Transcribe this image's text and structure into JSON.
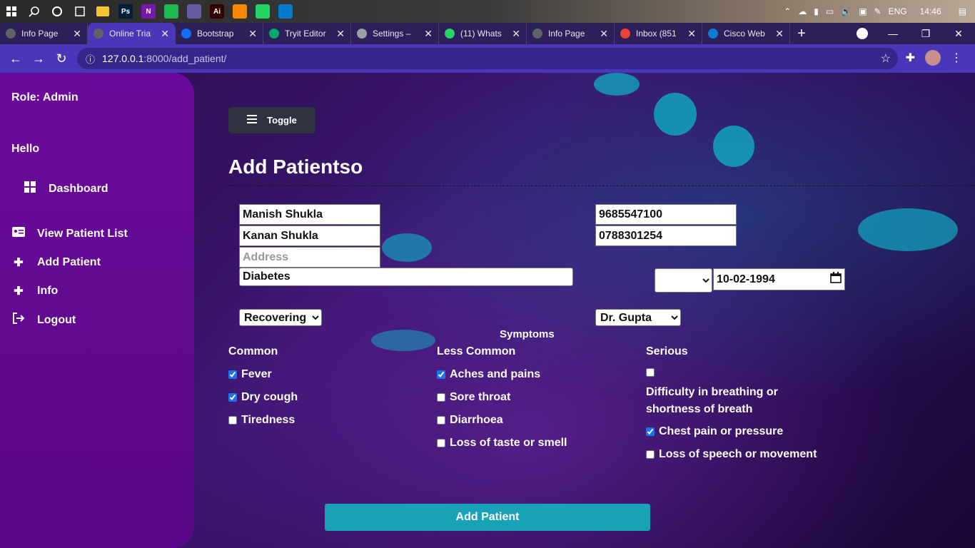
{
  "taskbar": {
    "lang": "ENG",
    "time": "14:46",
    "apps": [
      {
        "icon": "photoshop-icon",
        "label": "Ps",
        "color": "#001e36"
      },
      {
        "icon": "onenote-icon",
        "label": "N",
        "color": "#7719aa"
      },
      {
        "icon": "spotify-icon",
        "label": "",
        "color": "#1db954"
      },
      {
        "icon": "chrome-icon",
        "label": "",
        "color": "#6b5aa8"
      },
      {
        "icon": "illustrator-icon",
        "label": "Ai",
        "color": "#330000"
      },
      {
        "icon": "vlc-icon",
        "label": "",
        "color": "#ff8800"
      },
      {
        "icon": "whatsapp-icon",
        "label": "",
        "color": "#25d366"
      },
      {
        "icon": "vscode-icon",
        "label": "",
        "color": "#007acc"
      }
    ]
  },
  "tabs": [
    {
      "label": "Info Page",
      "icon": "globe-icon",
      "color": "#5f6368"
    },
    {
      "label": "Online Tria",
      "icon": "globe-icon",
      "color": "#5f6368",
      "active": true
    },
    {
      "label": "Bootstrap",
      "icon": "webflow-icon",
      "color": "#146ef5"
    },
    {
      "label": "Tryit Editor",
      "icon": "w3schools-icon",
      "color": "#04aa6d"
    },
    {
      "label": "Settings –",
      "icon": "gear-icon",
      "color": "#9aa0a6"
    },
    {
      "label": "(11) Whats",
      "icon": "whatsapp-icon",
      "color": "#25d366"
    },
    {
      "label": "Info Page",
      "icon": "globe-icon",
      "color": "#5f6368"
    },
    {
      "label": "Inbox (851",
      "icon": "gmail-icon",
      "color": "#ea4335"
    },
    {
      "label": "Cisco Web",
      "icon": "webex-icon",
      "color": "#0b7ad1"
    }
  ],
  "browser": {
    "url_host": "127.0.0.1",
    "url_path": ":8000/add_patient/"
  },
  "sidebar": {
    "role": "Role: Admin",
    "hello": "Hello",
    "items": [
      {
        "label": "Dashboard",
        "icon": "grid-icon"
      },
      {
        "label": "View Patient List",
        "icon": "id-card-icon"
      },
      {
        "label": "Add Patient",
        "icon": "plus-icon"
      },
      {
        "label": "Info",
        "icon": "plus-icon"
      },
      {
        "label": "Logout",
        "icon": "logout-icon"
      }
    ]
  },
  "main": {
    "toggle_label": "Toggle",
    "title": "Add Patientso",
    "form": {
      "patient_name": "Manish Shukla",
      "guardian_name": "Kanan Shukla",
      "address_placeholder": "Address",
      "condition": "Diabetes",
      "phone1": "9685547100",
      "phone2": "0788301254",
      "gender_selected": "",
      "dob": "10-02-1994",
      "status_selected": "Recovering",
      "doctor_selected": "Dr. Gupta"
    },
    "symptoms_title": "Symptoms",
    "columns": {
      "common": "Common",
      "less_common": "Less Common",
      "serious": "Serious"
    },
    "common": [
      {
        "label": "Fever",
        "checked": true
      },
      {
        "label": "Dry cough",
        "checked": true
      },
      {
        "label": "Tiredness",
        "checked": false
      }
    ],
    "less_common": [
      {
        "label": "Aches and pains",
        "checked": true
      },
      {
        "label": "Sore throat",
        "checked": false
      },
      {
        "label": "Diarrhoea",
        "checked": false
      },
      {
        "label": "Loss of taste or smell",
        "checked": false
      }
    ],
    "serious": [
      {
        "label": "Difficulty in breathing or shortness of breath",
        "checked": false
      },
      {
        "label": "Chest pain or pressure",
        "checked": true
      },
      {
        "label": "Loss of speech or movement",
        "checked": false
      }
    ],
    "submit_label": "Add Patient"
  },
  "colors": {
    "sidebar": "#6a0a9a",
    "accent_button": "#17a2b8",
    "toggle_button": "#2f3240",
    "browser_chrome": "#4a36b8"
  }
}
